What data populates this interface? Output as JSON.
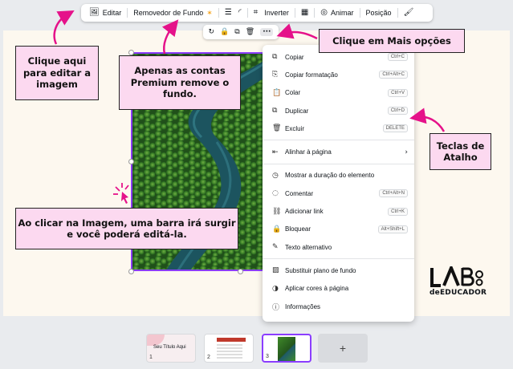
{
  "toolbar": {
    "edit_label": "Editar",
    "bg_remover_label": "Removedor de Fundo",
    "premium_badge": "✶",
    "flip_label": "Inverter",
    "animate_label": "Animar",
    "position_label": "Posição"
  },
  "mini_toolbar": {
    "more_label": "···"
  },
  "menu": {
    "items": [
      {
        "icon": "⧉",
        "label": "Copiar",
        "shortcut": "Ctrl+C"
      },
      {
        "icon": "⎘",
        "label": "Copiar formatação",
        "shortcut": "Ctrl+Alt+C"
      },
      {
        "icon": "📋",
        "label": "Colar",
        "shortcut": "Ctrl+V"
      },
      {
        "icon": "⧉",
        "label": "Duplicar",
        "shortcut": "Ctrl+D"
      },
      {
        "icon": "🗑",
        "label": "Excluir",
        "shortcut": "DELETE"
      },
      {
        "icon": "⇤",
        "label": "Alinhar à página",
        "shortcut": ""
      },
      {
        "icon": "◷",
        "label": "Mostrar a duração do elemento",
        "shortcut": ""
      },
      {
        "icon": "◌",
        "label": "Comentar",
        "shortcut": "Ctrl+Alt+N"
      },
      {
        "icon": "⛓",
        "label": "Adicionar link",
        "shortcut": "Ctrl+K"
      },
      {
        "icon": "🔒",
        "label": "Bloquear",
        "shortcut": "Alt+Shift+L"
      },
      {
        "icon": "✎",
        "label": "Texto alternativo",
        "shortcut": ""
      },
      {
        "icon": "▨",
        "label": "Substituir plano de fundo",
        "shortcut": ""
      },
      {
        "icon": "◑",
        "label": "Aplicar cores à página",
        "shortcut": ""
      },
      {
        "icon": "ⓘ",
        "label": "Informações",
        "shortcut": ""
      }
    ]
  },
  "callouts": {
    "edit_image": "Clique aqui para editar a imagem",
    "premium": "Apenas as contas Premium remove o fundo.",
    "more_options": "Clique em Mais opções",
    "shortcuts": "Teclas de Atalho",
    "image_bar": "Ao clicar na Imagem, uma barra irá surgir e você poderá editá-la."
  },
  "logo": {
    "text": "deEDUCADOR"
  },
  "pages": {
    "thumb1_title": "Seu Título Aqui",
    "thumb1_num": "1",
    "thumb2_num": "2",
    "thumb3_num": "3",
    "add_label": "+"
  },
  "colors": {
    "accent": "#e5128a",
    "callout_bg": "#fcd9f0",
    "selection": "#8b3dff"
  }
}
